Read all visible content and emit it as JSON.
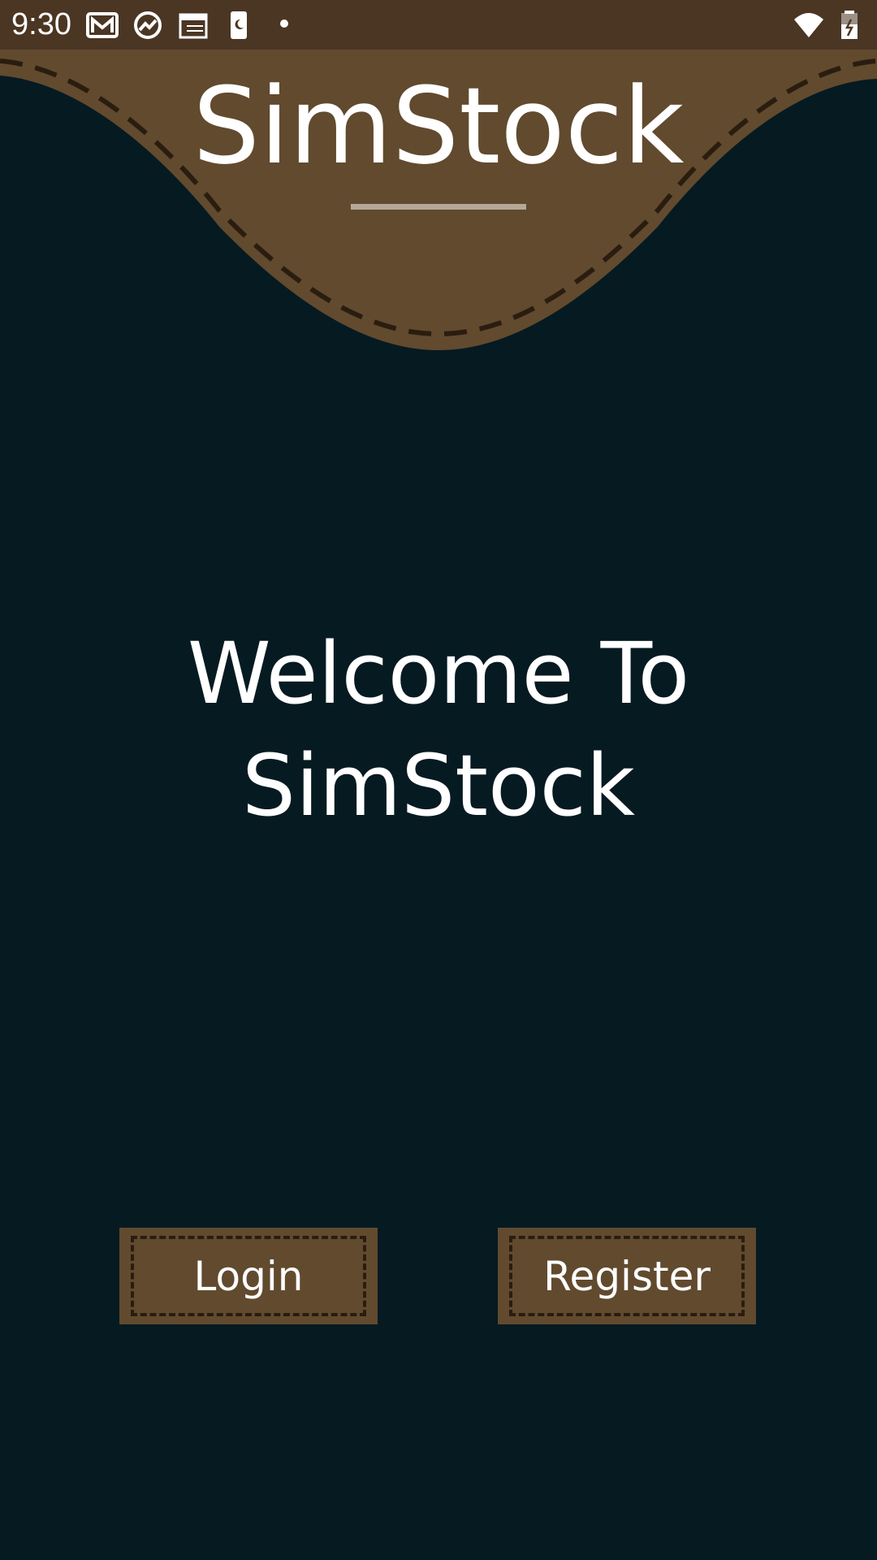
{
  "status_bar": {
    "time": "9:30",
    "icons": [
      "gmail-icon",
      "sync-chart-icon",
      "calendar-icon",
      "phone-sleep-icon",
      "dot-icon",
      "wifi-icon",
      "battery-icon"
    ]
  },
  "header": {
    "title": "SimStock"
  },
  "main": {
    "welcome_line1": "Welcome To",
    "welcome_line2": "SimStock"
  },
  "actions": {
    "login_label": "Login",
    "register_label": "Register"
  },
  "colors": {
    "background": "#061a22",
    "brown": "#614a2e",
    "status_bar": "#4a3623",
    "dash": "#2a1d10"
  }
}
